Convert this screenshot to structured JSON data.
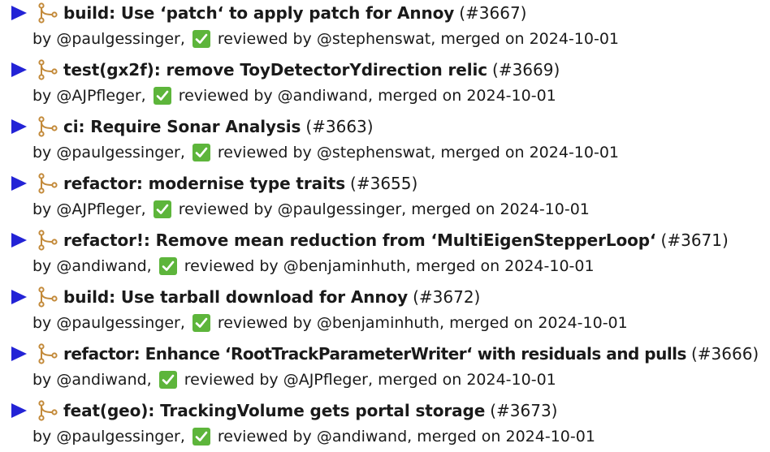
{
  "colors": {
    "bullet": "#2323d6",
    "merge_icon": "#c38a3a",
    "check_bg": "#5db53b",
    "check_mark": "#ffffff",
    "text": "#1a1a1a"
  },
  "icons": {
    "bullet": "triangle-right-icon",
    "merge": "git-merge-icon",
    "review": "check-box-icon"
  },
  "labels": {
    "by": "by",
    "reviewed_by": "reviewed by",
    "merged_on": "merged on"
  },
  "prs": [
    {
      "title": "build: Use ‘patch‘ to apply patch for Annoy",
      "number": "(#3667)",
      "author": "@paulgessinger,",
      "reviewer": "@stephenswat,",
      "date": "2024-10-01"
    },
    {
      "title": "test(gx2f): remove ToyDetectorYdirection relic",
      "number": "(#3669)",
      "author": "@AJPfleger,",
      "reviewer": "@andiwand,",
      "date": "2024-10-01"
    },
    {
      "title": "ci: Require Sonar Analysis",
      "number": "(#3663)",
      "author": "@paulgessinger,",
      "reviewer": "@stephenswat,",
      "date": "2024-10-01"
    },
    {
      "title": "refactor: modernise type traits",
      "number": "(#3655)",
      "author": "@AJPfleger,",
      "reviewer": "@paulgessinger,",
      "date": "2024-10-01"
    },
    {
      "title": "refactor!: Remove mean reduction from ‘MultiEigenStepperLoop‘",
      "number": "(#3671)",
      "author": "@andiwand,",
      "reviewer": "@benjaminhuth,",
      "date": "2024-10-01"
    },
    {
      "title": "build: Use tarball download for Annoy",
      "number": "(#3672)",
      "author": "@paulgessinger,",
      "reviewer": "@benjaminhuth,",
      "date": "2024-10-01"
    },
    {
      "title": "refactor: Enhance ‘RootTrackParameterWriter‘ with residuals and pulls",
      "number": "(#3666)",
      "author": "@andiwand,",
      "reviewer": "@AJPfleger,",
      "date": "2024-10-01"
    },
    {
      "title": "feat(geo): TrackingVolume gets portal storage",
      "number": "(#3673)",
      "author": "@paulgessinger,",
      "reviewer": "@andiwand,",
      "date": "2024-10-01"
    }
  ]
}
